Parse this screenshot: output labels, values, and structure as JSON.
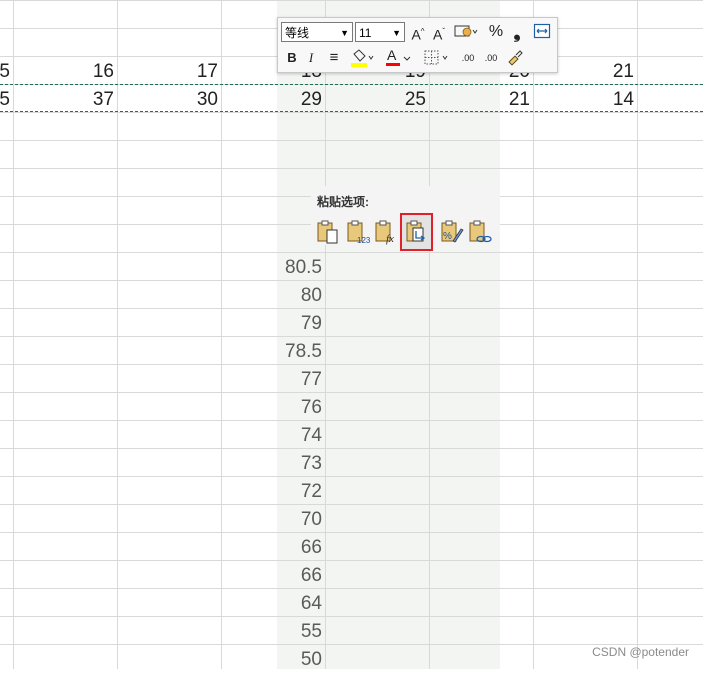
{
  "sheet": {
    "row1": [
      "5",
      "16",
      "17",
      "18",
      "19",
      "20",
      "21"
    ],
    "row2": [
      "5",
      "37",
      "30",
      "29",
      "25",
      "21",
      "14"
    ],
    "pasted_values": [
      "80.5",
      "80",
      "79",
      "78.5",
      "77",
      "76",
      "74",
      "73",
      "72",
      "70",
      "66",
      "66",
      "64",
      "55",
      "50"
    ]
  },
  "toolbar": {
    "font_name": "等线",
    "font_size": "11",
    "grow_font": "A",
    "shrink_font": "A",
    "percent": "%",
    "comma": "❟",
    "bold": "B",
    "italic": "I",
    "align": "≡",
    "font_color": "A",
    "inc_decimal": ".00",
    "dec_decimal": ".00",
    "highlight_color": "#ffff00",
    "font_color_bar": "#ff0000"
  },
  "paste_options": {
    "title": "粘贴选项:",
    "buttons": [
      "paste",
      "values",
      "formulas",
      "transpose",
      "formatting",
      "paste-link"
    ],
    "selected": "transpose"
  },
  "watermark": "CSDN @potender"
}
